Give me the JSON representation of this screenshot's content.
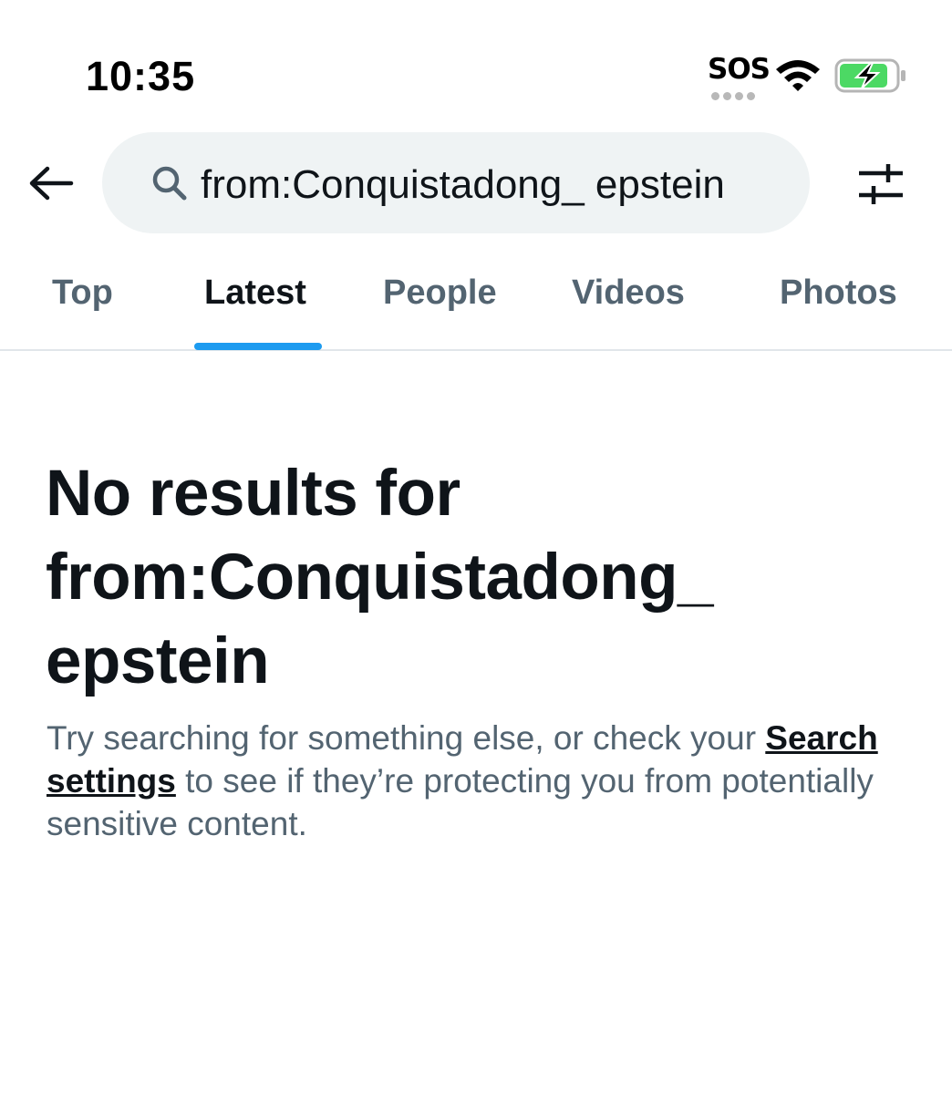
{
  "status_bar": {
    "time": "10:35",
    "carrier_status": "SOS",
    "battery_color": "#4cd964"
  },
  "header": {
    "search_query": "from:Conquistadong_ epstein",
    "icons": [
      "back-arrow-icon",
      "search-icon",
      "filter-settings-icon"
    ]
  },
  "tabs": [
    {
      "label": "Top",
      "active": false
    },
    {
      "label": "Latest",
      "active": true
    },
    {
      "label": "People",
      "active": false
    },
    {
      "label": "Videos",
      "active": false
    },
    {
      "label": "Photos",
      "active": false
    }
  ],
  "empty_state": {
    "title_lines": [
      "No results for",
      "from:Conquistadong_",
      "epstein"
    ],
    "desc_before": "Try searching for something else, or check your ",
    "link_label": "Search settings",
    "desc_after": " to see if they’re protecting you from potentially sensitive content."
  },
  "colors": {
    "accent": "#1d9bf0",
    "text_primary": "#0f1419",
    "text_secondary": "#536471",
    "search_bg": "#eff3f4"
  }
}
